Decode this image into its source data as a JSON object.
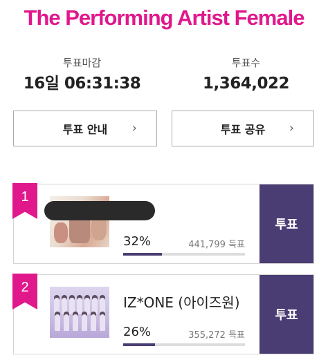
{
  "page": {
    "title": "The Performing Artist Female"
  },
  "stats": {
    "deadline_label": "투표마감",
    "deadline_value": "16일 06:31:38",
    "count_label": "투표수",
    "count_value": "1,364,022"
  },
  "actions": {
    "guide_label": "투표 안내",
    "share_label": "투표 공유",
    "chevron": "›"
  },
  "entries": [
    {
      "rank": "1",
      "name": "",
      "name_redacted": true,
      "percent_label": "32%",
      "percent": 32,
      "votes_label": "441,799 득표",
      "vote_button": "투표",
      "thumb_icon": "album-cover-image"
    },
    {
      "rank": "2",
      "name": "IZ*ONE (아이즈원)",
      "name_redacted": false,
      "percent_label": "26%",
      "percent": 26,
      "votes_label": "355,272 득표",
      "vote_button": "투표",
      "thumb_icon": "group-photo-image"
    }
  ],
  "colors": {
    "accent": "#e0188c",
    "vote_button": "#4a3d74",
    "progress_fill": "#4a3d74"
  }
}
